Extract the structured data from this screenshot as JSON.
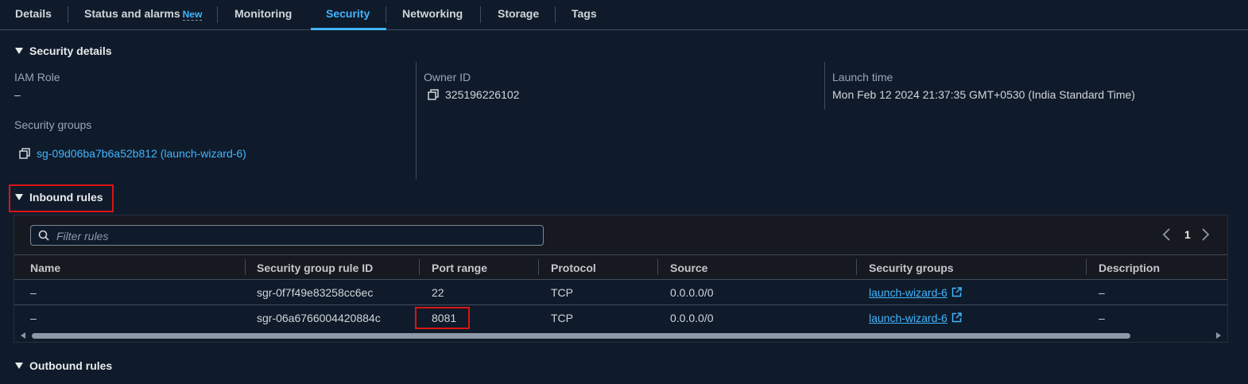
{
  "tabs": [
    {
      "label": "Details"
    },
    {
      "label": "Status and alarms",
      "badge": "New"
    },
    {
      "label": "Monitoring"
    },
    {
      "label": "Security",
      "active": true
    },
    {
      "label": "Networking"
    },
    {
      "label": "Storage"
    },
    {
      "label": "Tags"
    }
  ],
  "security_details": {
    "title": "Security details",
    "iam_role_label": "IAM Role",
    "iam_role_value": "–",
    "owner_id_label": "Owner ID",
    "owner_id_value": "325196226102",
    "launch_time_label": "Launch time",
    "launch_time_value": "Mon Feb 12 2024 21:37:35 GMT+0530 (India Standard Time)",
    "security_groups_label": "Security groups",
    "security_groups_value": "sg-09d06ba7b6a52b812 (launch-wizard-6)"
  },
  "inbound": {
    "title": "Inbound rules",
    "filter_placeholder": "Filter rules",
    "page": "1",
    "columns": [
      "Name",
      "Security group rule ID",
      "Port range",
      "Protocol",
      "Source",
      "Security groups",
      "Description"
    ],
    "rows": [
      {
        "name": "–",
        "rule_id": "sgr-0f7f49e83258cc6ec",
        "port": "22",
        "protocol": "TCP",
        "source": "0.0.0.0/0",
        "sg": "launch-wizard-6",
        "desc": "–"
      },
      {
        "name": "–",
        "rule_id": "sgr-06a6766004420884c",
        "port": "8081",
        "protocol": "TCP",
        "source": "0.0.0.0/0",
        "sg": "launch-wizard-6",
        "desc": "–"
      }
    ]
  },
  "outbound": {
    "title": "Outbound rules"
  },
  "colors": {
    "accent": "#42b4ff",
    "highlight": "#d91515",
    "background": "#0f1b2a"
  }
}
